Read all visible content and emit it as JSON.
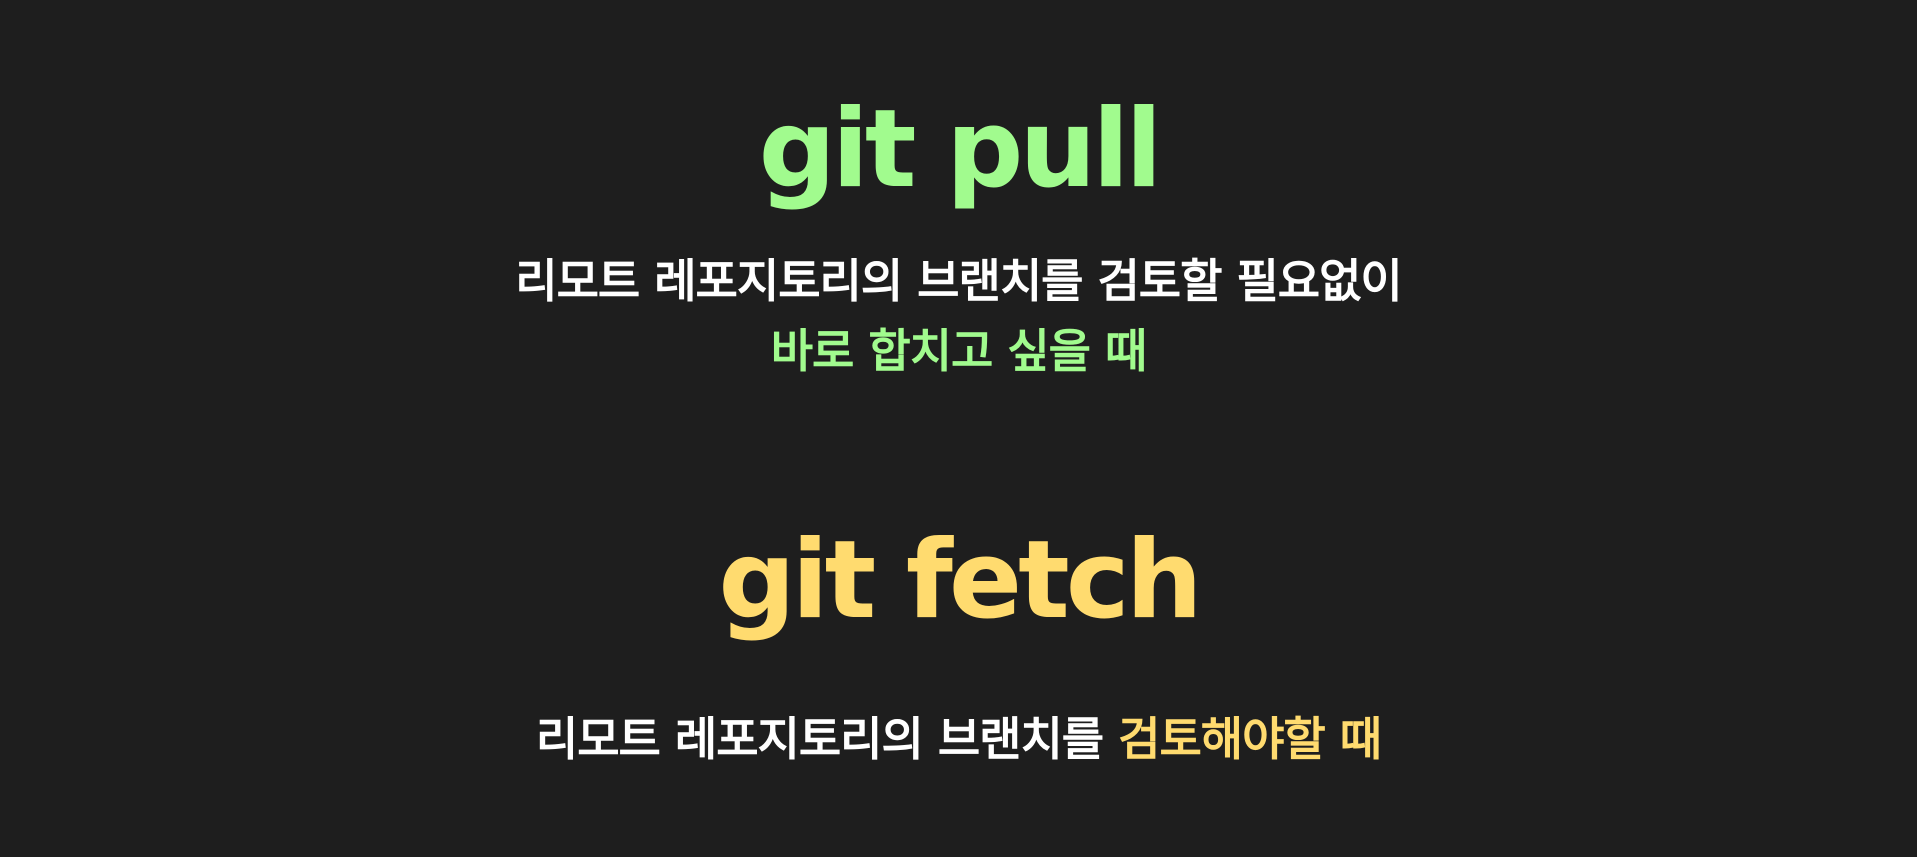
{
  "colors": {
    "background": "#1e1e1e",
    "pull_accent": "#a1fb8e",
    "fetch_accent": "#ffdb6f",
    "text": "#ffffff"
  },
  "pull": {
    "title": "git pull",
    "line1": "리모트 레포지토리의 브랜치를 검토할 필요없이",
    "line2": "바로 합치고 싶을 때"
  },
  "fetch": {
    "title": "git fetch",
    "line1_plain": "리모트 레포지토리의 브랜치를 ",
    "line1_highlight": "검토해야할 때"
  }
}
